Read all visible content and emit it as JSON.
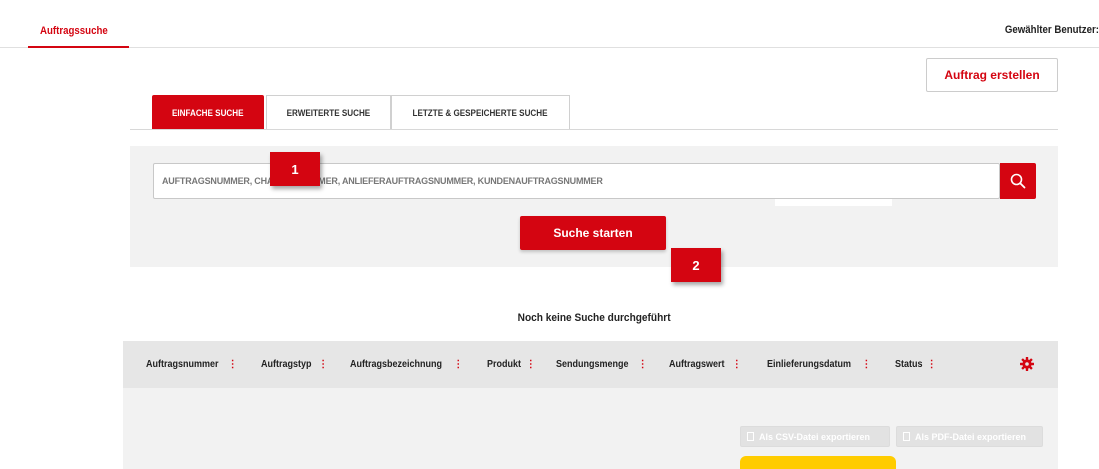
{
  "nav": {
    "tab_label": "Auftragssuche",
    "user_label": "Gewählter Benutzer:"
  },
  "actions": {
    "create_order_label": "Auftrag erstellen"
  },
  "tabs": [
    {
      "label": "EINFACHE SUCHE",
      "active": true
    },
    {
      "label": "ERWEITERTE SUCHE",
      "active": false
    },
    {
      "label": "LETZTE & GESPEICHERTE SUCHE",
      "active": false
    }
  ],
  "search": {
    "placeholder": "AUFTRAGSNUMMER, CHARGENNUMMER, ANLIEFERAUFTRAGSNUMMER, KUNDENAUFTRAGSNUMMER",
    "start_label": "Suche starten",
    "search_icon": "search-icon"
  },
  "markers": [
    "1",
    "2"
  ],
  "results": {
    "empty_message": "Noch keine Suche durchgeführt",
    "columns": [
      "Auftragsnummer",
      "Auftragstyp",
      "Auftragsbezeichnung",
      "Produkt",
      "Sendungsmenge",
      "Auftragswert",
      "Einlieferungsdatum",
      "Status"
    ],
    "sort_indicator": "⋮",
    "settings_icon": "gear-icon",
    "export_csv_label": "Als CSV-Datei exportieren",
    "export_pdf_label": "Als PDF-Datei exportieren"
  },
  "colors": {
    "brand_red": "#d40511",
    "brand_yellow": "#ffcc00",
    "panel_gray": "#f2f2f2",
    "header_gray": "#e6e6e6"
  }
}
